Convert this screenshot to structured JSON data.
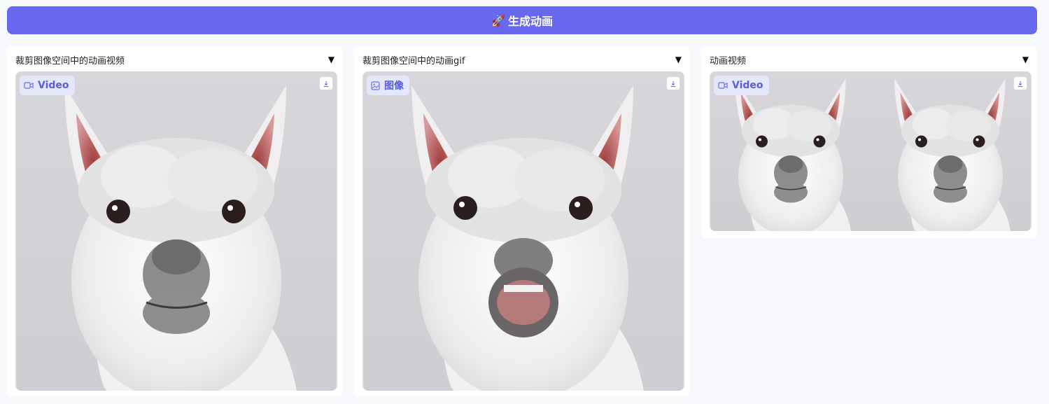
{
  "generate_button": {
    "icon": "rocket-icon",
    "label": "生成动画"
  },
  "panels": [
    {
      "title": "裁剪图像空间中的动画视频",
      "badge": "Video",
      "badge_icon": "video-camera-icon"
    },
    {
      "title": "裁剪图像空间中的动画gif",
      "badge": "图像",
      "badge_icon": "image-icon"
    },
    {
      "title": "动画视频",
      "badge": "Video",
      "badge_icon": "video-camera-icon"
    }
  ],
  "colors": {
    "accent": "#6767ef",
    "badge_bg": "#e4e6fb",
    "badge_text": "#5a5fd6"
  }
}
